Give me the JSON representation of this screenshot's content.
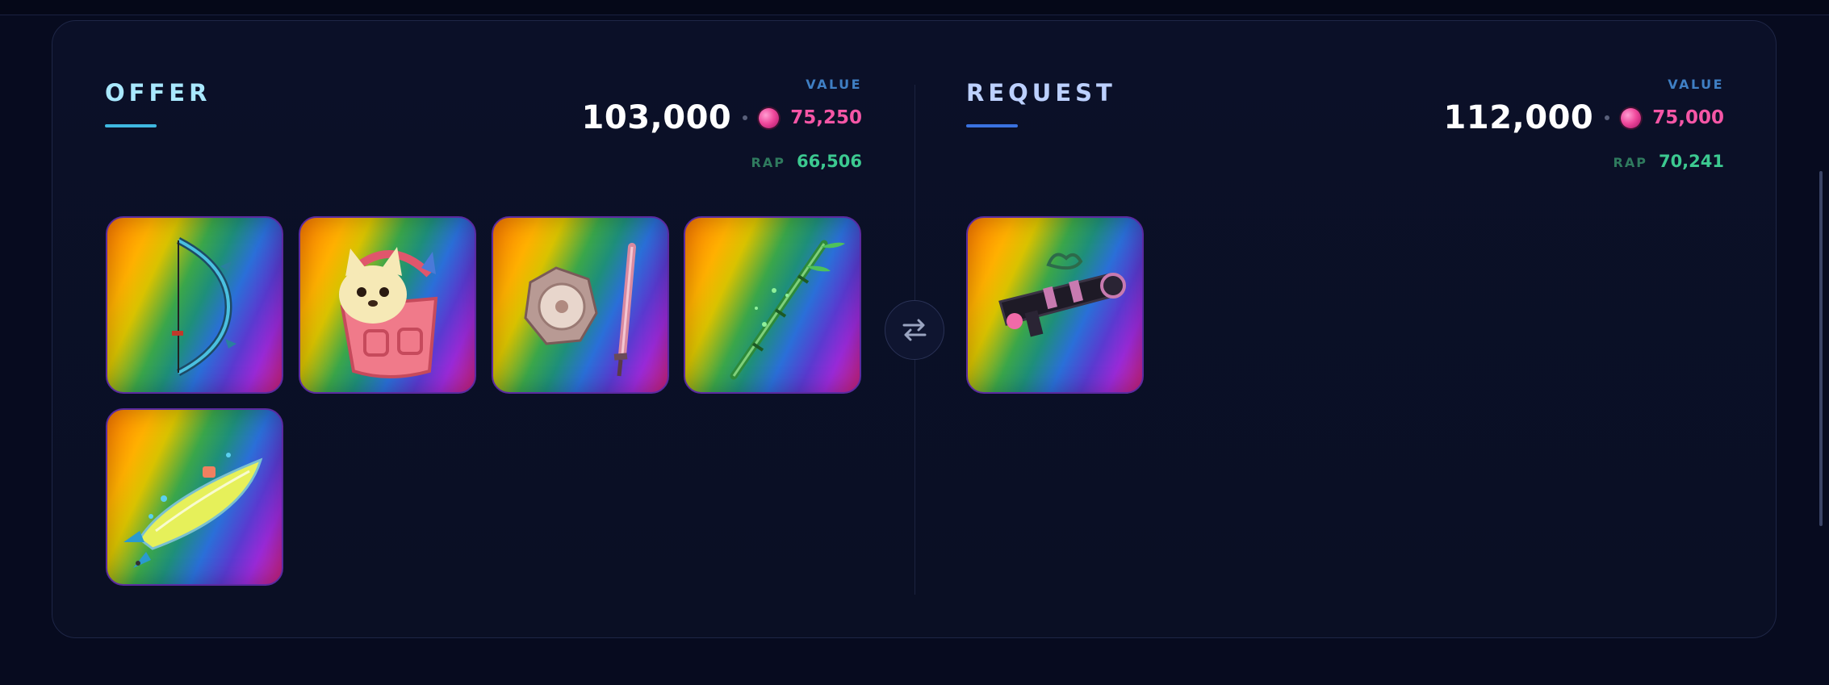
{
  "offer": {
    "title": "OFFER",
    "value_label": "VALUE",
    "value": "103,000",
    "gems": "75,250",
    "rap_label": "RAP",
    "rap": "66,506",
    "items": [
      {
        "icon": "bow-icon"
      },
      {
        "icon": "dog-in-basket-icon"
      },
      {
        "icon": "flower-shield-and-sword-icon"
      },
      {
        "icon": "bamboo-staff-icon"
      },
      {
        "icon": "surfboard-icon"
      }
    ]
  },
  "request": {
    "title": "REQUEST",
    "value_label": "VALUE",
    "value": "112,000",
    "gems": "75,000",
    "rap_label": "RAP",
    "rap": "70,241",
    "items": [
      {
        "icon": "launcher-gun-icon"
      }
    ]
  },
  "swap_icon": "swap-arrows-icon",
  "colors": {
    "offer_title": "#a9e8ff",
    "request_title": "#bcd0ff",
    "gem_pink": "#f556a6",
    "rap_green": "#3cc990",
    "value_label_blue": "#3f7fc4"
  }
}
